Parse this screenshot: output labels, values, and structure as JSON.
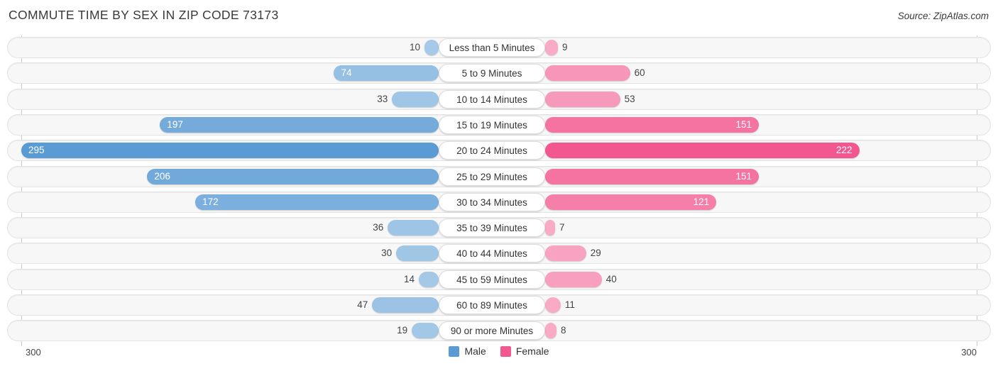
{
  "header": {
    "title": "COMMUTE TIME BY SEX IN ZIP CODE 73173",
    "source": "Source: ZipAtlas.com"
  },
  "axis": {
    "left_label": "300",
    "right_label": "300",
    "max": 300
  },
  "legend": {
    "items": [
      {
        "label": "Male",
        "color": "#5b9bd5"
      },
      {
        "label": "Female",
        "color": "#f2578f"
      }
    ]
  },
  "colors": {
    "male_min": "#a8cbe8",
    "male_max": "#5b9bd5",
    "female_min": "#f9aec8",
    "female_max": "#f2578f",
    "track": "#f7f7f7",
    "gridline": "#c9c9c9"
  },
  "chart_data": {
    "type": "bar",
    "title": "COMMUTE TIME BY SEX IN ZIP CODE 73173",
    "subtitle": "Source: ZipAtlas.com",
    "xlabel": "",
    "ylabel": "",
    "orientation": "horizontal-diverging",
    "xlim": [
      300,
      300
    ],
    "grid": true,
    "legend_position": "bottom-center",
    "categories": [
      "Less than 5 Minutes",
      "5 to 9 Minutes",
      "10 to 14 Minutes",
      "15 to 19 Minutes",
      "20 to 24 Minutes",
      "25 to 29 Minutes",
      "30 to 34 Minutes",
      "35 to 39 Minutes",
      "40 to 44 Minutes",
      "45 to 59 Minutes",
      "60 to 89 Minutes",
      "90 or more Minutes"
    ],
    "series": [
      {
        "name": "Male",
        "color": "#5b9bd5",
        "direction": "left",
        "values": [
          10,
          74,
          33,
          197,
          295,
          206,
          172,
          36,
          30,
          14,
          47,
          19
        ]
      },
      {
        "name": "Female",
        "color": "#f2578f",
        "direction": "right",
        "values": [
          9,
          60,
          53,
          151,
          222,
          151,
          121,
          7,
          29,
          40,
          11,
          8
        ]
      }
    ]
  }
}
